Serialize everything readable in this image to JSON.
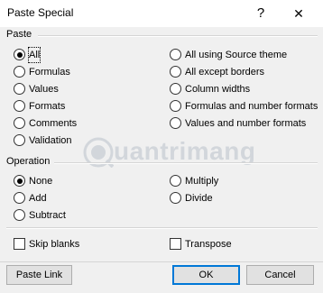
{
  "window": {
    "title": "Paste Special",
    "help_glyph": "?",
    "close_glyph": "✕"
  },
  "paste": {
    "group_label": "Paste",
    "options": [
      {
        "label": "All",
        "selected": true
      },
      {
        "label": "Formulas",
        "selected": false
      },
      {
        "label": "Values",
        "selected": false
      },
      {
        "label": "Formats",
        "selected": false
      },
      {
        "label": "Comments",
        "selected": false
      },
      {
        "label": "Validation",
        "selected": false
      },
      {
        "label": "All using Source theme",
        "selected": false
      },
      {
        "label": "All except borders",
        "selected": false
      },
      {
        "label": "Column widths",
        "selected": false
      },
      {
        "label": "Formulas and number formats",
        "selected": false
      },
      {
        "label": "Values and number formats",
        "selected": false
      }
    ]
  },
  "operation": {
    "group_label": "Operation",
    "options": [
      {
        "label": "None",
        "selected": true
      },
      {
        "label": "Add",
        "selected": false
      },
      {
        "label": "Subtract",
        "selected": false
      },
      {
        "label": "Multiply",
        "selected": false
      },
      {
        "label": "Divide",
        "selected": false
      }
    ]
  },
  "checks": {
    "skip_blanks": {
      "label": "Skip blanks",
      "checked": false
    },
    "transpose": {
      "label": "Transpose",
      "checked": false
    }
  },
  "buttons": {
    "paste_link": "Paste Link",
    "ok": "OK",
    "cancel": "Cancel"
  },
  "watermark": {
    "text": "uantrimang"
  }
}
